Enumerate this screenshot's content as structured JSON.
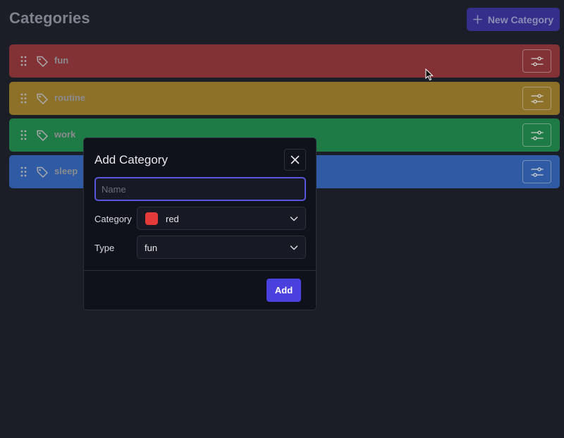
{
  "header": {
    "title": "Categories",
    "new_button_label": "New Category"
  },
  "categories": [
    {
      "label": "fun",
      "color": "#823135",
      "icon": "tag-icon"
    },
    {
      "label": "routine",
      "color": "#8d7129",
      "icon": "tag-icon"
    },
    {
      "label": "work",
      "color": "#1f7b45",
      "icon": "tag-icon"
    },
    {
      "label": "sleep",
      "color": "#2e5ba4",
      "icon": "tag-icon"
    }
  ],
  "modal": {
    "title": "Add Category",
    "name_placeholder": "Name",
    "name_value": "",
    "category_label": "Category",
    "category_value": "red",
    "category_swatch_color": "#e53a3a",
    "type_label": "Type",
    "type_value": "fun",
    "add_label": "Add"
  },
  "colors": {
    "accent": "#4a40dd",
    "background": "#1b1e27",
    "modal_background": "#0f121b"
  }
}
